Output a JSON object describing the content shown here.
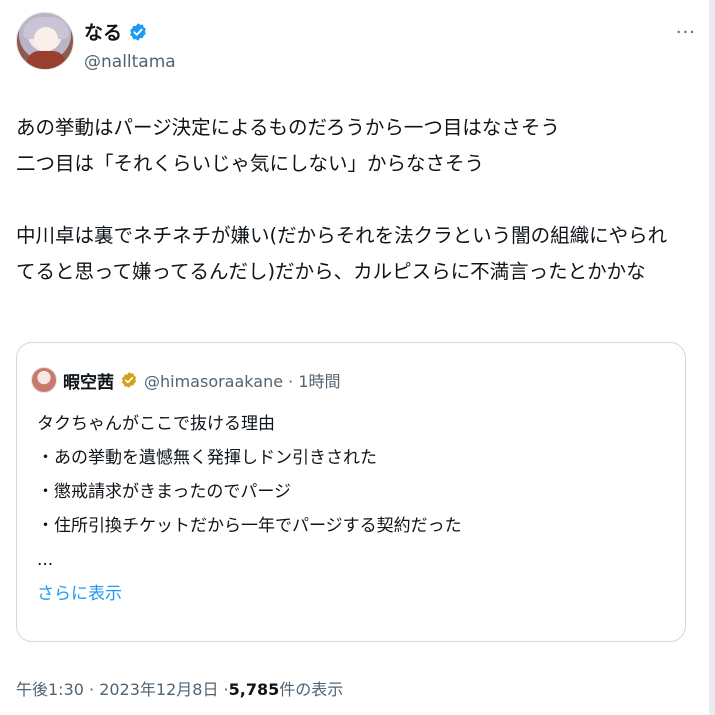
{
  "author": {
    "display_name": "なる",
    "handle": "@nalltama"
  },
  "more_label": "···",
  "tweet": {
    "lines": [
      "あの挙動はパージ決定によるものだろうから一つ目はなさそう",
      "二つ目は「それくらいじゃ気にしない」からなさそう",
      "",
      "中川卓は裏でネチネチが嫌い(だからそれを法クラという闇の組織にやられ",
      "てると思って嫌ってるんだし)だから、カルピスらに不満言ったとかかな"
    ]
  },
  "quoted": {
    "display_name": "暇空茜",
    "handle_time": "@himasoraakane · 1時間",
    "lines": [
      "タクちゃんがここで抜ける理由",
      "・あの挙動を遺憾無く発揮しドン引きされた",
      "・懲戒請求がきまったのでパージ",
      "・住所引換チケットだから一年でパージする契約だった",
      "..."
    ],
    "show_more": "さらに表示"
  },
  "footer": {
    "datetime": "午後1:30 · 2023年12月8日 · ",
    "views": "5,785",
    "views_label": " 件の表示"
  },
  "colors": {
    "accent": "#1d9bf0",
    "text": "#0f1419",
    "muted": "#536471"
  }
}
